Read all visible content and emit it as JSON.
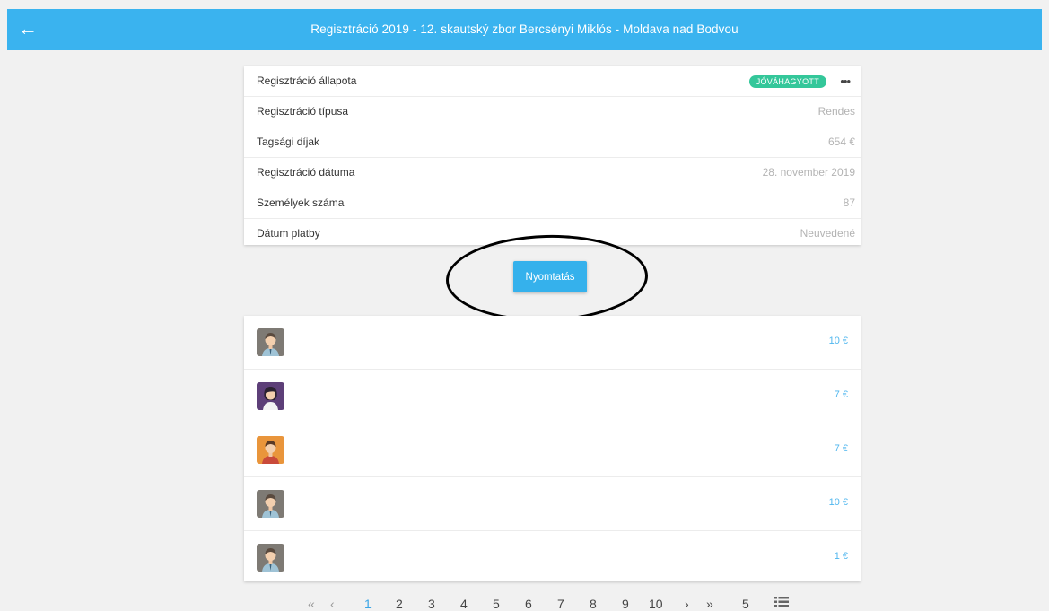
{
  "header": {
    "back_icon": "arrow-left-icon",
    "title": "Regisztráció 2019 - 12. skautský zbor Bercsényi Miklós - Moldava nad Bodvou"
  },
  "info": {
    "status_label": "Regisztráció állapota",
    "status_badge": "JÓVÁHAGYOTT",
    "more_icon": "more-horizontal-icon",
    "more_text": "•••",
    "rows": [
      {
        "label": "Regisztráció típusa",
        "value": "Rendes"
      },
      {
        "label": "Tagsági díjak",
        "value": "654 €"
      },
      {
        "label": "Regisztráció dátuma",
        "value": "28. november 2019"
      },
      {
        "label": "Személyek száma",
        "value": "87"
      },
      {
        "label": "Dátum platby",
        "value": "Neuvedené"
      }
    ]
  },
  "print_button": "Nyomtatás",
  "people": [
    {
      "avatar": "male-avatar-icon",
      "amount": "10 €"
    },
    {
      "avatar": "female-avatar-icon",
      "amount": "7 €"
    },
    {
      "avatar": "male-avatar-icon",
      "amount": "7 €"
    },
    {
      "avatar": "male-avatar-icon",
      "amount": "10 €"
    },
    {
      "avatar": "male-avatar-icon",
      "amount": "1 €"
    }
  ],
  "pagination": {
    "first": "«",
    "prev": "‹",
    "pages": [
      "1",
      "2",
      "3",
      "4",
      "5",
      "6",
      "7",
      "8",
      "9",
      "10"
    ],
    "current": "1",
    "next": "›",
    "last": "»",
    "per_page": "5",
    "list_icon": "list-icon"
  },
  "colors": {
    "header": "#3ab3ef",
    "badge": "#34c79a",
    "amount": "#4fb6ee",
    "button": "#35b1ec"
  }
}
